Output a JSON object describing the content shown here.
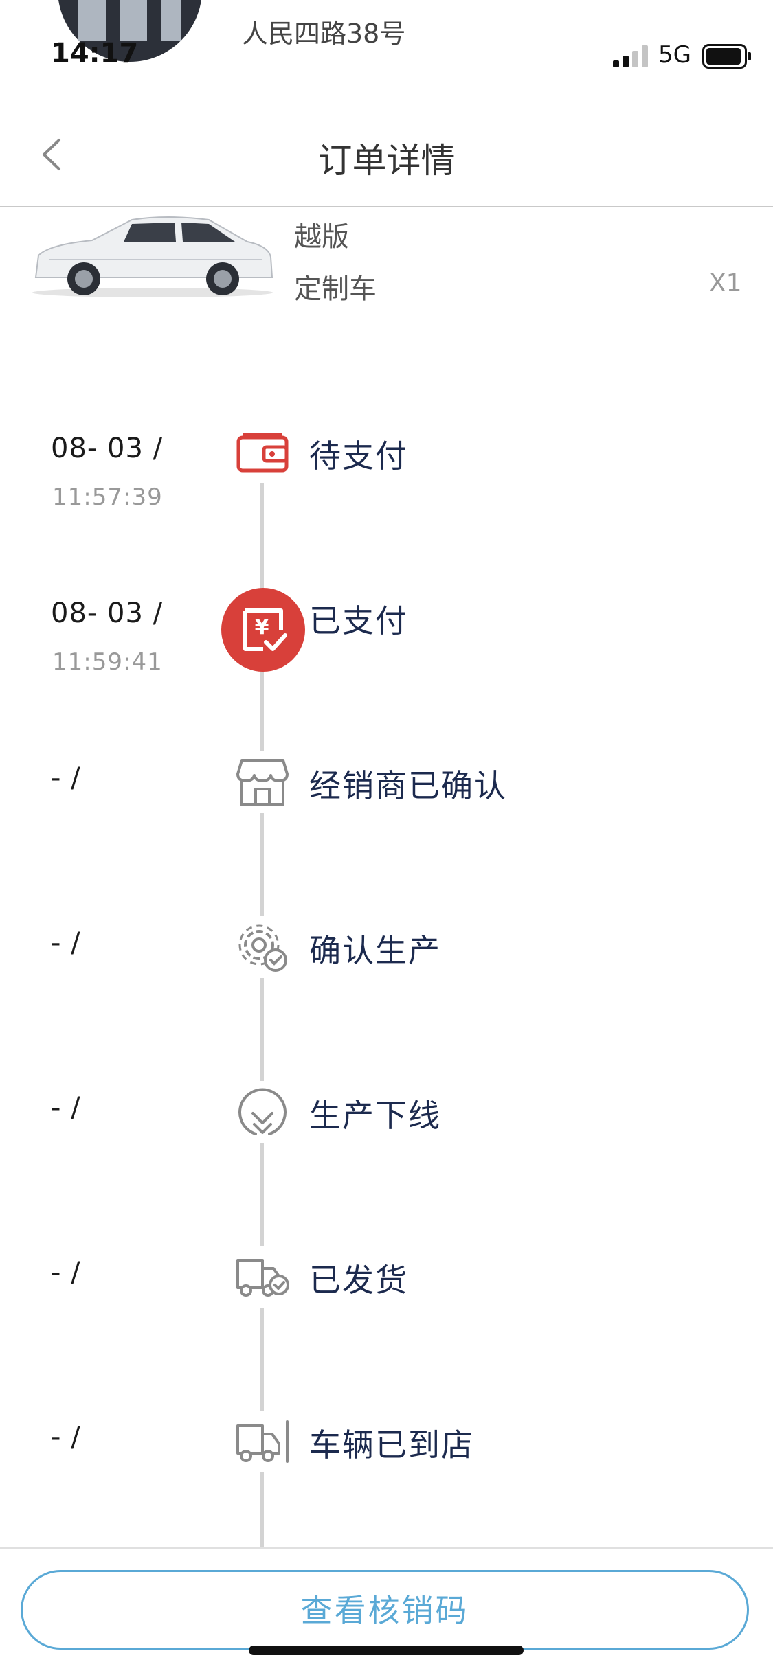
{
  "status_bar": {
    "time": "14:17",
    "network": "5G",
    "address_text": "人民四路38号"
  },
  "nav": {
    "title": "订单详情",
    "back_icon": "chevron-left-icon"
  },
  "product": {
    "name_line_1": "越版",
    "name_line_2": "定制车",
    "quantity": "X1"
  },
  "timeline": {
    "steps": [
      {
        "date": "08- 03 /",
        "time": "11:57:39",
        "label": "待支付",
        "icon": "wallet-icon"
      },
      {
        "date": "08- 03 /",
        "time": "11:59:41",
        "label": "已支付",
        "icon": "paid-receipt-icon"
      },
      {
        "date": "- /",
        "time": "",
        "label": "经销商已确认",
        "icon": "store-icon"
      },
      {
        "date": "- /",
        "time": "",
        "label": "确认生产",
        "icon": "gear-check-icon"
      },
      {
        "date": "- /",
        "time": "",
        "label": "生产下线",
        "icon": "down-arrow-circle-icon"
      },
      {
        "date": "- /",
        "time": "",
        "label": "已发货",
        "icon": "truck-check-icon"
      },
      {
        "date": "- /",
        "time": "",
        "label": "车辆已到店",
        "icon": "truck-arrived-icon"
      }
    ]
  },
  "footer": {
    "button_label": "查看核销码"
  },
  "colors": {
    "accent_red": "#d8403a",
    "accent_blue": "#5aa9d6",
    "timeline_line": "#d3d3d3",
    "label_dark": "#1c2a4e"
  }
}
